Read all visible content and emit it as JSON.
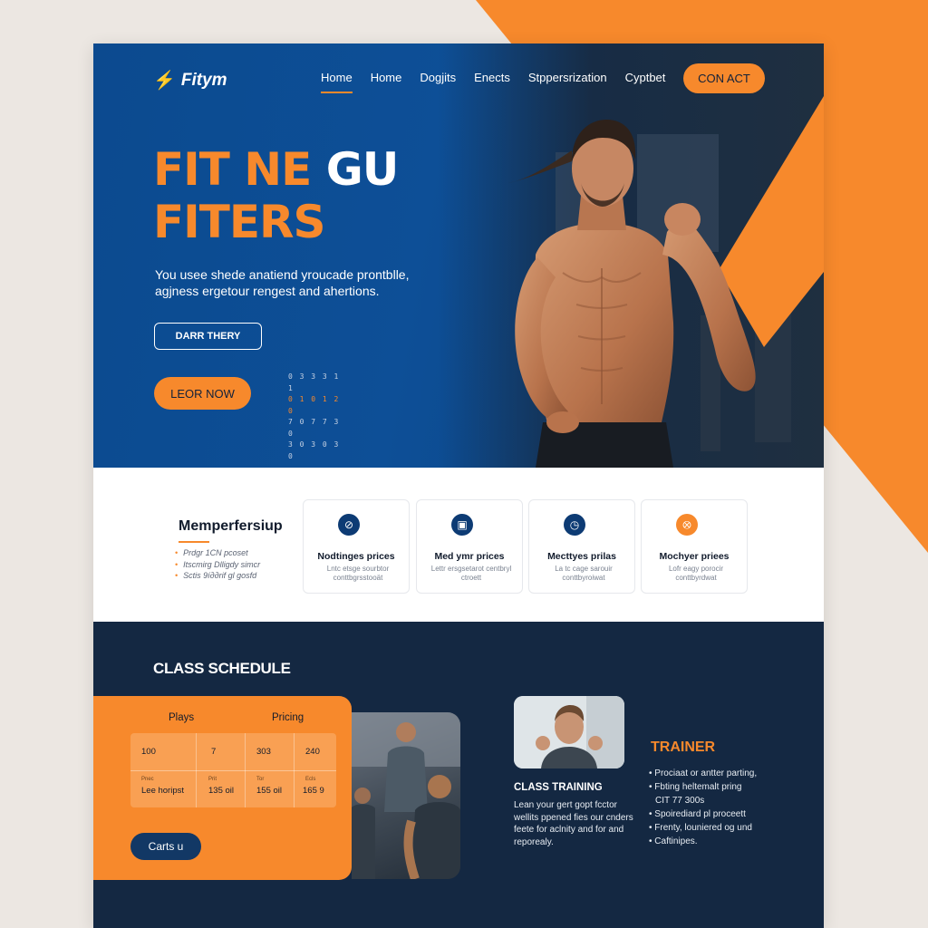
{
  "header": {
    "logo_text": "Fitym",
    "nav": [
      {
        "label": "Home",
        "active": true
      },
      {
        "label": "Home",
        "active": false
      },
      {
        "label": "Dogjits",
        "active": false
      },
      {
        "label": "Enects",
        "active": false
      },
      {
        "label": "Stppersrization",
        "active": false
      },
      {
        "label": "Cyptbet",
        "active": false
      }
    ],
    "contact_label": "CON ACT"
  },
  "hero": {
    "title_line1_orange": "FIT NE ",
    "title_line1_white": "GU",
    "title_line2": "FITERS",
    "subtitle": "You usee shede anatiend yroucade prontblle, agjness ergetour rengest and ahertions.",
    "outline_button": "DARR THERY",
    "cta_button": "LEOR NOW",
    "dot_grid": [
      "0 3 3 3 1 1",
      "0 1 0 1 2 0",
      "7 0 7 7 3 0",
      "3 0 3 0 3 0"
    ]
  },
  "membership": {
    "title": "Memperfersiup",
    "list": [
      "Prdgr 1CN pcoset",
      "Itscmirg Dlligdy simcr",
      "Sctis 9íддrif gl gosfd"
    ],
    "cards": [
      {
        "icon": "compass-icon",
        "glyph": "⊘",
        "title": "Nodtinges prices",
        "desc": "Lntc etsge sourbtor conttbgrsstooät",
        "accent": false
      },
      {
        "icon": "calendar-icon",
        "glyph": "▣",
        "title": "Med ymr prices",
        "desc": "Lettr ersgsetarot centbryl ctroett",
        "accent": false
      },
      {
        "icon": "stopwatch-icon",
        "glyph": "◷",
        "title": "Mecttyes prilas",
        "desc": "La tc cage sarouir conttbyroiwat",
        "accent": false
      },
      {
        "icon": "shield-icon",
        "glyph": "⭙",
        "title": "Mochyer priees",
        "desc": "Lofr eagy porocir conttbyrdwat",
        "accent": true
      }
    ]
  },
  "schedule": {
    "title": "CLASS SCHEDULE",
    "col_plays": "Plays",
    "col_pricing": "Pricing",
    "row1": [
      "100",
      "7",
      "303",
      "240"
    ],
    "row2_small": [
      "Pnec",
      "Prit",
      "Tor",
      "Ecls"
    ],
    "row2": [
      "Lee horipst",
      "135 oil",
      "155 oil",
      "165 9"
    ],
    "button": "Carts u",
    "class_training_title": "CLASS TRAINING",
    "class_training_desc": "Lean your gert gopt fcctor wellits ppened fies our cnders feete for aclnity and for and reporealy.",
    "trainer_title": "TRAINER",
    "trainer_list": [
      {
        "text": "Prociaat or antter parting,",
        "bullet": true
      },
      {
        "text": "Fbting heltemalt pring",
        "bullet": true
      },
      {
        "text": "CIT 77 300s",
        "bullet": false
      },
      {
        "text": "Spoirediard pl proceett",
        "bullet": true
      },
      {
        "text": "Frenty, louniered og und",
        "bullet": true
      },
      {
        "text": "Caftinipes.",
        "bullet": true
      }
    ]
  },
  "colors": {
    "brand_blue": "#0c4a8f",
    "accent_orange": "#f7892c",
    "navy": "#142842"
  }
}
